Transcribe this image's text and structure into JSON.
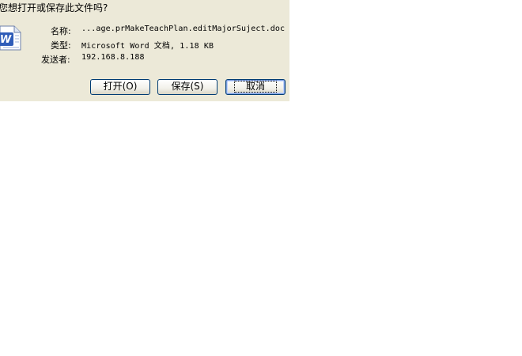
{
  "dialog": {
    "question": "您想打开或保存此文件吗?",
    "icon": "word-document-icon",
    "fields": [
      {
        "label": "名称:",
        "value": "...age.prMakeTeachPlan.editMajorSuject.doc"
      },
      {
        "label": "类型:",
        "value": "Microsoft Word 文档, 1.18 KB"
      },
      {
        "label": "发送者:",
        "value": "192.168.8.188"
      }
    ],
    "buttons": {
      "open": "打开(O)",
      "save": "保存(S)",
      "cancel": "取消"
    }
  },
  "colors": {
    "dialog_bg": "#ece9d8",
    "button_border": "#003c74",
    "page_bg": "#ffffff"
  }
}
